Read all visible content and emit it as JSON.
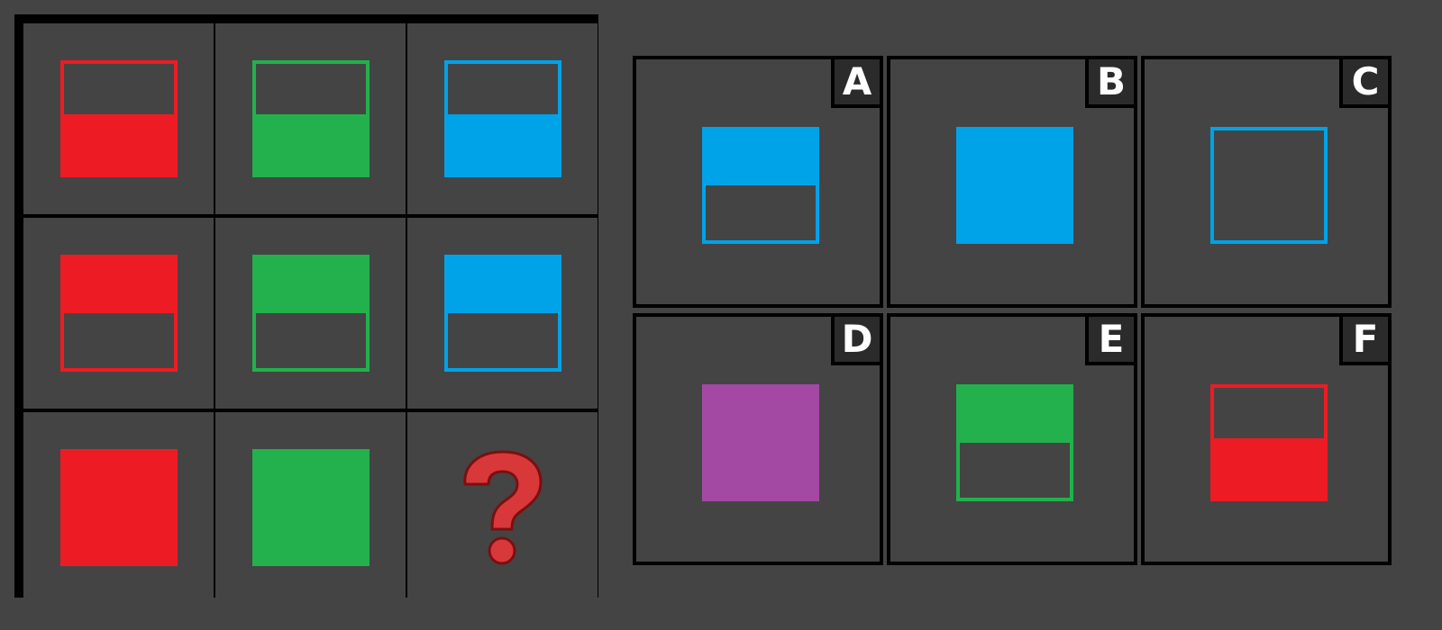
{
  "colors": {
    "background": "#444444",
    "red": "#ed1c24",
    "green": "#22b14c",
    "blue": "#00a2e8",
    "purple": "#a349a4",
    "question_mark": "#d9383a"
  },
  "grid": {
    "cells": [
      {
        "shape": "bottom-filled",
        "color": "red"
      },
      {
        "shape": "bottom-filled",
        "color": "green"
      },
      {
        "shape": "bottom-filled",
        "color": "blue"
      },
      {
        "shape": "top-filled",
        "color": "red"
      },
      {
        "shape": "top-filled",
        "color": "green"
      },
      {
        "shape": "top-filled",
        "color": "blue"
      },
      {
        "shape": "filled",
        "color": "red"
      },
      {
        "shape": "filled",
        "color": "green"
      },
      {
        "shape": "question-mark",
        "color": "question_mark"
      }
    ]
  },
  "options": [
    {
      "label": "A",
      "shape": "top-filled",
      "color": "blue"
    },
    {
      "label": "B",
      "shape": "filled",
      "color": "blue"
    },
    {
      "label": "C",
      "shape": "outline",
      "color": "blue"
    },
    {
      "label": "D",
      "shape": "filled",
      "color": "purple"
    },
    {
      "label": "E",
      "shape": "top-filled",
      "color": "green"
    },
    {
      "label": "F",
      "shape": "bottom-filled",
      "color": "red"
    }
  ]
}
